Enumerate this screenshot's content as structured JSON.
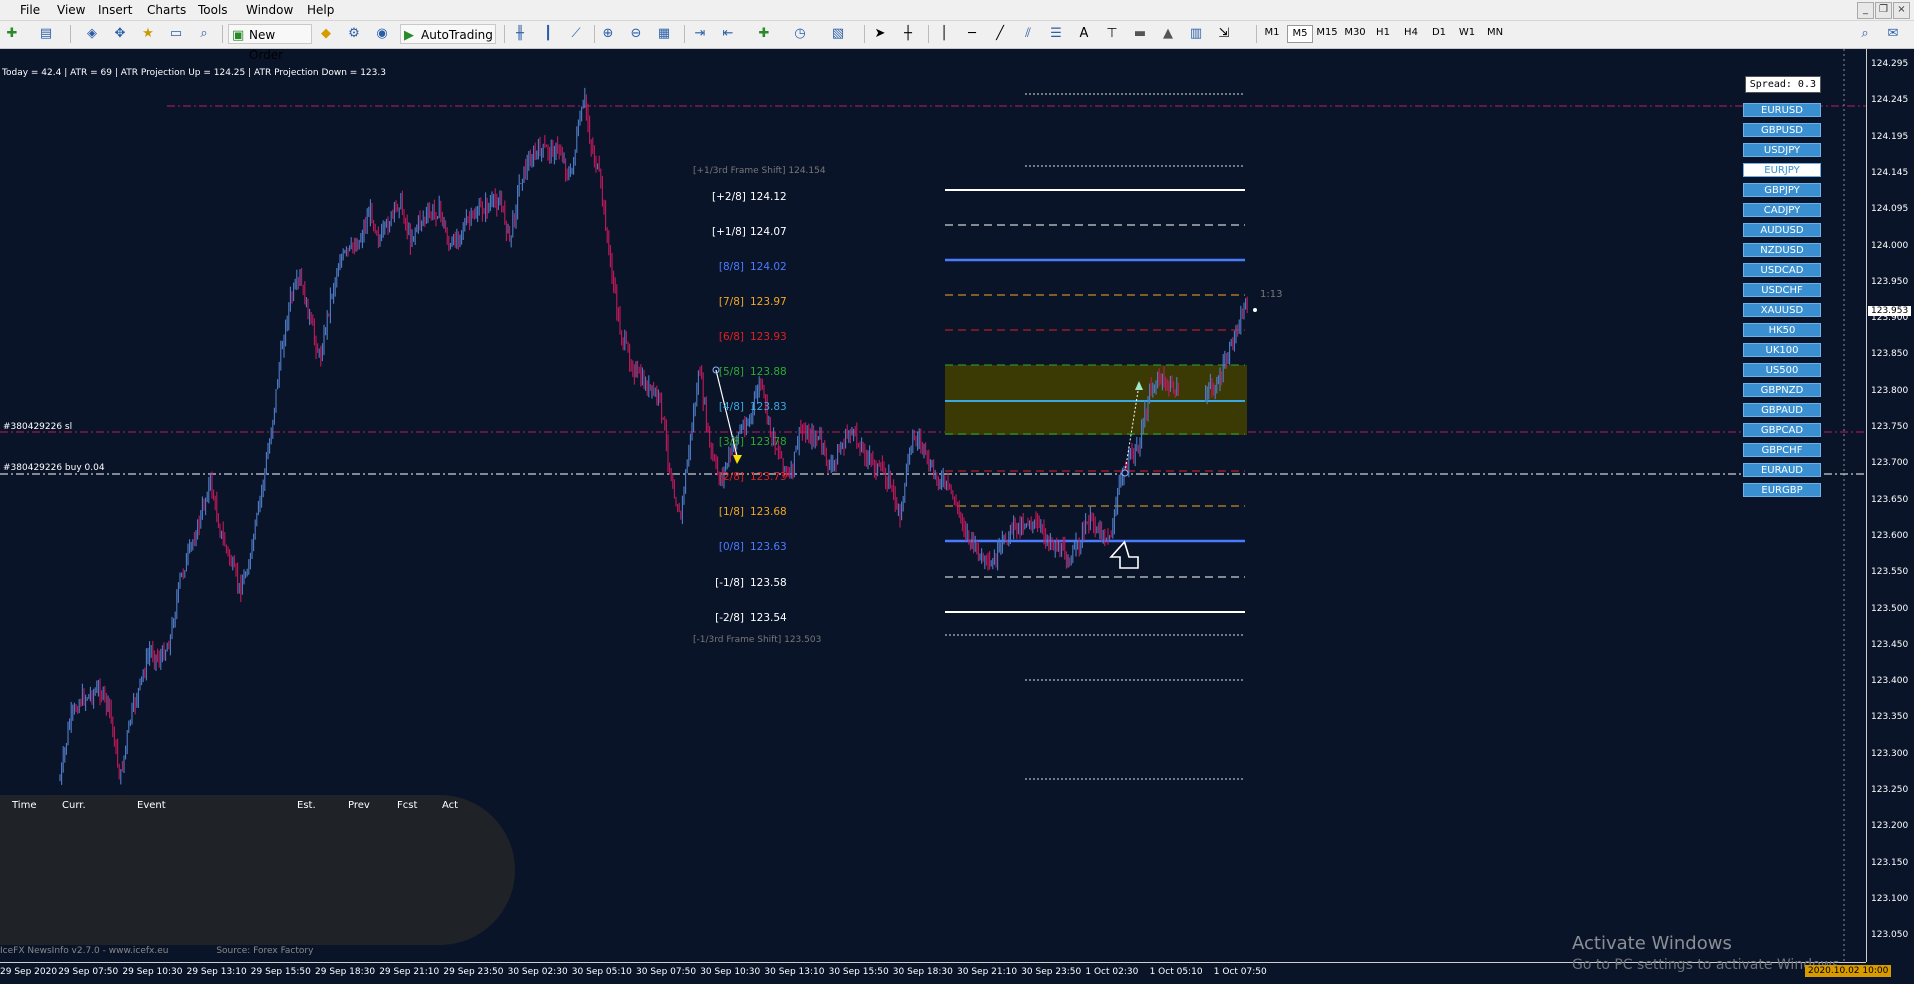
{
  "menu": [
    "File",
    "View",
    "Insert",
    "Charts",
    "Tools",
    "Window",
    "Help"
  ],
  "toolbar": {
    "new_order": "New Order",
    "autotrading": "AutoTrading",
    "timeframes": [
      "M1",
      "M5",
      "M15",
      "M30",
      "H1",
      "H4",
      "D1",
      "W1",
      "MN"
    ],
    "active_timeframe": "M5"
  },
  "hud": {
    "text": "Today = 42.4    |    ATR = 69    |    ATR Projection Up = 124.25    |    ATR Projection Down = 123.3"
  },
  "spread": "Spread: 0.3",
  "symbols": [
    "EURUSD",
    "GBPUSD",
    "USDJPY",
    "EURJPY",
    "GBPJPY",
    "CADJPY",
    "AUDUSD",
    "NZDUSD",
    "USDCAD",
    "USDCHF",
    "XAUUSD",
    "HK50",
    "UK100",
    "US500",
    "GBPNZD",
    "GBPAUD",
    "GBPCAD",
    "GBPCHF",
    "EURAUD",
    "EURGBP"
  ],
  "active_symbol": "EURJPY",
  "murrey": {
    "frame_shift_up": "[+1/3rd Frame Shift]  124.154",
    "frame_shift_down": "[-1/3rd Frame Shift]  123.503",
    "levels": [
      {
        "tag": "[+2/8]",
        "value": "124.12",
        "color": "#ffffff"
      },
      {
        "tag": "[+1/8]",
        "value": "124.07",
        "color": "#ffffff"
      },
      {
        "tag": "[8/8]",
        "value": "124.02",
        "color": "#4a7bff"
      },
      {
        "tag": "[7/8]",
        "value": "123.97",
        "color": "#f5a623"
      },
      {
        "tag": "[6/8]",
        "value": "123.93",
        "color": "#e02020"
      },
      {
        "tag": "[5/8]",
        "value": "123.88",
        "color": "#2eaa2e"
      },
      {
        "tag": "[4/8]",
        "value": "123.83",
        "color": "#3ba8e0"
      },
      {
        "tag": "[3/8]",
        "value": "123.78",
        "color": "#2eaa2e"
      },
      {
        "tag": "[2/8]",
        "value": "123.73",
        "color": "#e02020"
      },
      {
        "tag": "[1/8]",
        "value": "123.68",
        "color": "#f5a623"
      },
      {
        "tag": "[0/8]",
        "value": "123.63",
        "color": "#4a7bff"
      },
      {
        "tag": "[-1/8]",
        "value": "123.58",
        "color": "#ffffff"
      },
      {
        "tag": "[-2/8]",
        "value": "123.54",
        "color": "#ffffff"
      }
    ]
  },
  "orders": {
    "sl": "#380429226 sl",
    "buy": "#380429226 buy 0.04"
  },
  "bar_timer": "1:13",
  "price_scale": [
    "124.295",
    "124.245",
    "124.195",
    "124.145",
    "124.095",
    "124.000",
    "123.950",
    "123.900",
    "123.850",
    "123.800",
    "123.750",
    "123.700",
    "123.650",
    "123.600",
    "123.550",
    "123.500",
    "123.450",
    "123.400",
    "123.350",
    "123.300",
    "123.250",
    "123.200",
    "123.150",
    "123.100",
    "123.050"
  ],
  "current_price": "123.953",
  "time_scale": [
    "29 Sep 2020",
    "29 Sep 07:50",
    "29 Sep 10:30",
    "29 Sep 13:10",
    "29 Sep 15:50",
    "29 Sep 18:30",
    "29 Sep 21:10",
    "29 Sep 23:50",
    "30 Sep 02:30",
    "30 Sep 05:10",
    "30 Sep 07:50",
    "30 Sep 10:30",
    "30 Sep 13:10",
    "30 Sep 15:50",
    "30 Sep 18:30",
    "30 Sep 21:10",
    "30 Sep 23:50",
    "1 Oct 02:30",
    "1 Oct 05:10",
    "1 Oct 07:50"
  ],
  "date_badge": "2020.10.02 10:00",
  "news": {
    "headers": [
      "Time",
      "Curr.",
      "Event",
      "Est.",
      "Prev",
      "Fcst",
      "Act"
    ],
    "footer_left": "IceFX NewsInfo v2.7.0  -  www.icefx.eu",
    "footer_right": "Source: Forex Factory"
  },
  "activate": {
    "title": "Activate Windows",
    "subtitle": "Go to PC settings to activate Windows."
  },
  "colors": {
    "background": "#0a1428",
    "bull_candle": "#4f7dc9",
    "bear_candle": "#c2185b",
    "symbol_button": "#3a8fd0",
    "zone_fill": "#3b3a05"
  }
}
